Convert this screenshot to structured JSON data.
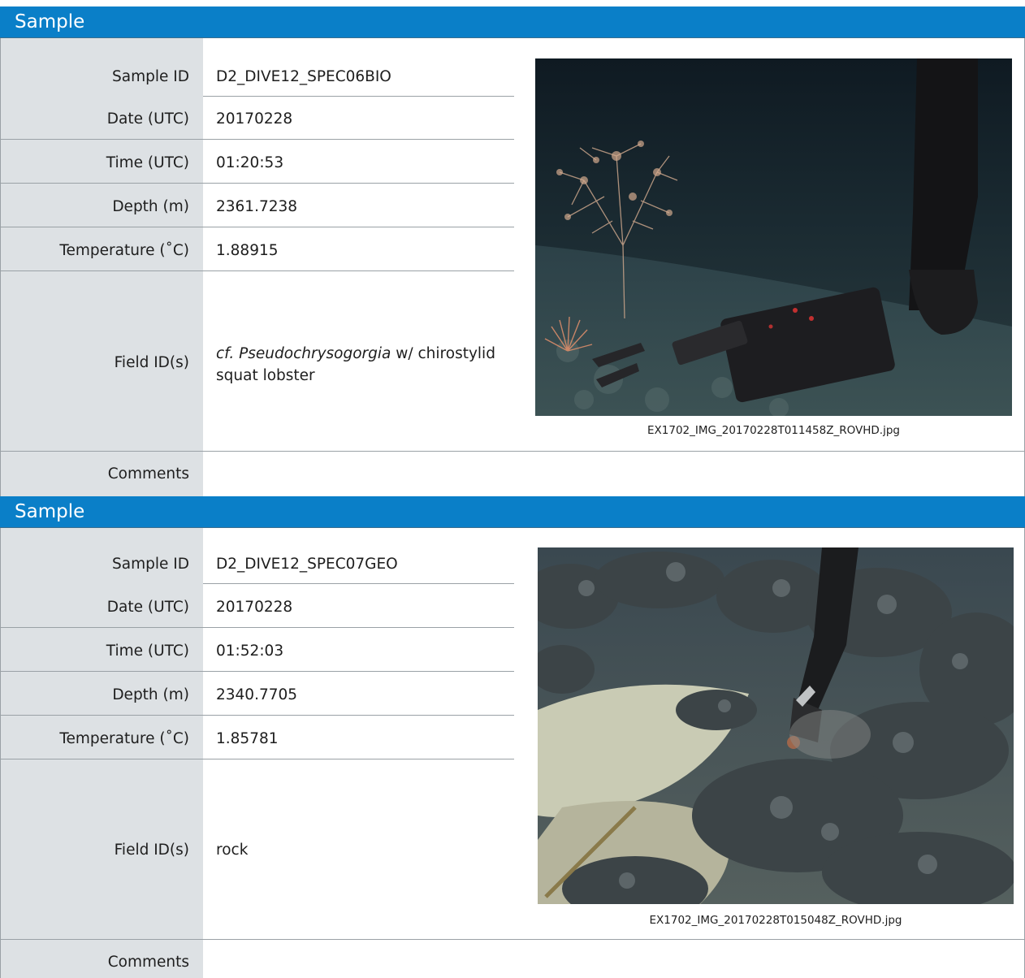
{
  "samples": [
    {
      "header": "Sample",
      "labels": {
        "sample_id": "Sample ID",
        "date": "Date (UTC)",
        "time": "Time (UTC)",
        "depth": "Depth (m)",
        "temperature": "Temperature (˚C)",
        "field_ids": "Field ID(s)",
        "comments": "Comments"
      },
      "values": {
        "sample_id": "D2_DIVE12_SPEC06BIO",
        "date": "20170228",
        "time": "01:20:53",
        "depth": "2361.7238",
        "temperature": "1.88915",
        "field_ids_italic": "cf. Pseudochrysogorgia",
        "field_ids_rest": " w/ chirostylid squat lobster",
        "comments": ""
      },
      "image_caption": "EX1702_IMG_20170228T011458Z_ROVHD.jpg"
    },
    {
      "header": "Sample",
      "labels": {
        "sample_id": "Sample ID",
        "date": "Date (UTC)",
        "time": "Time (UTC)",
        "depth": "Depth (m)",
        "temperature": "Temperature (˚C)",
        "field_ids": "Field ID(s)",
        "comments": "Comments"
      },
      "values": {
        "sample_id": "D2_DIVE12_SPEC07GEO",
        "date": "20170228",
        "time": "01:52:03",
        "depth": "2340.7705",
        "temperature": "1.85781",
        "field_ids": "rock",
        "comments": ""
      },
      "image_caption": "EX1702_IMG_20170228T015048Z_ROVHD.jpg"
    }
  ],
  "colors": {
    "header_bg": "#0a7fc8",
    "label_col_bg": "#dde1e4",
    "rule": "#9aa1a6"
  }
}
